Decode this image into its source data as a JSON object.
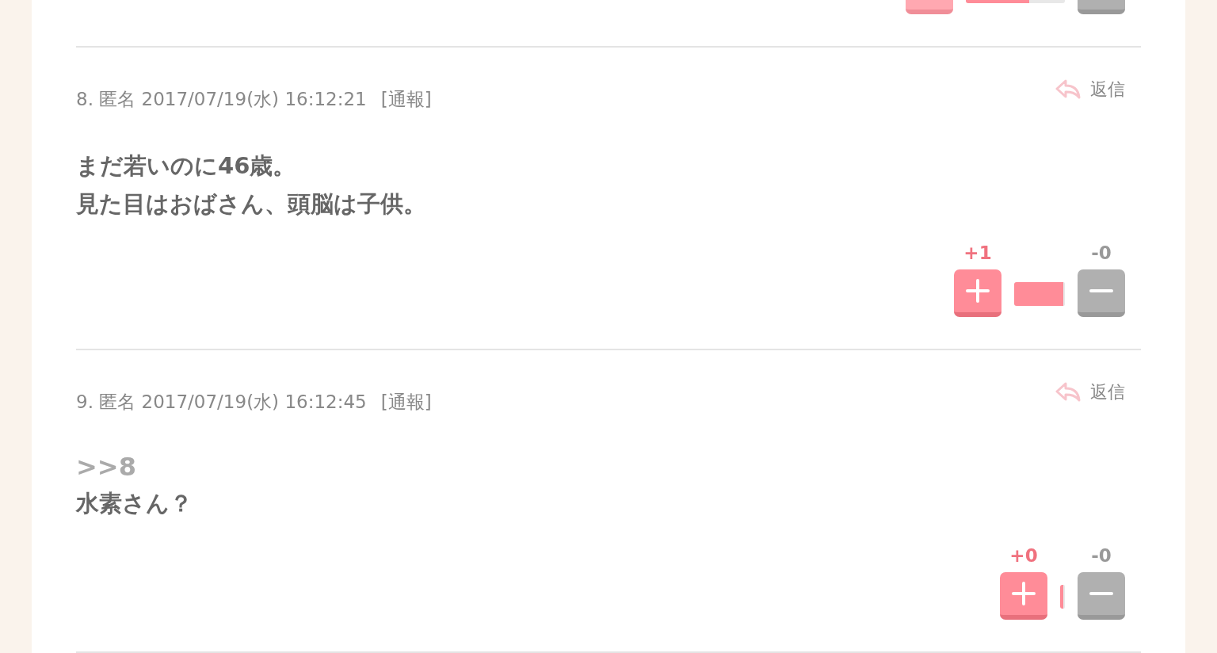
{
  "previous_votes": {
    "plus_dimmed": true,
    "plus_fill": {
      "level": 0.64
    },
    "minus_fill": {
      "level": 0.36
    }
  },
  "comments": [
    {
      "header": "8. 匿名 2017/07/19(水) 16:12:21",
      "report": "[通報]",
      "reply": "返信",
      "lines": [
        "まだ若いのに46歳。",
        "見た目はおばさん、頭脳は子供。"
      ],
      "votes": {
        "plus": "+1",
        "minus": "-0",
        "plus_dimmed": false
      }
    },
    {
      "header": "9. 匿名 2017/07/19(水) 16:12:45",
      "report": "[通報]",
      "reply": "返信",
      "anchor": ">>8",
      "lines": [
        "水素さん？"
      ],
      "votes": {
        "plus": "+0",
        "minus": "-0",
        "plus_dimmed": false
      }
    }
  ]
}
